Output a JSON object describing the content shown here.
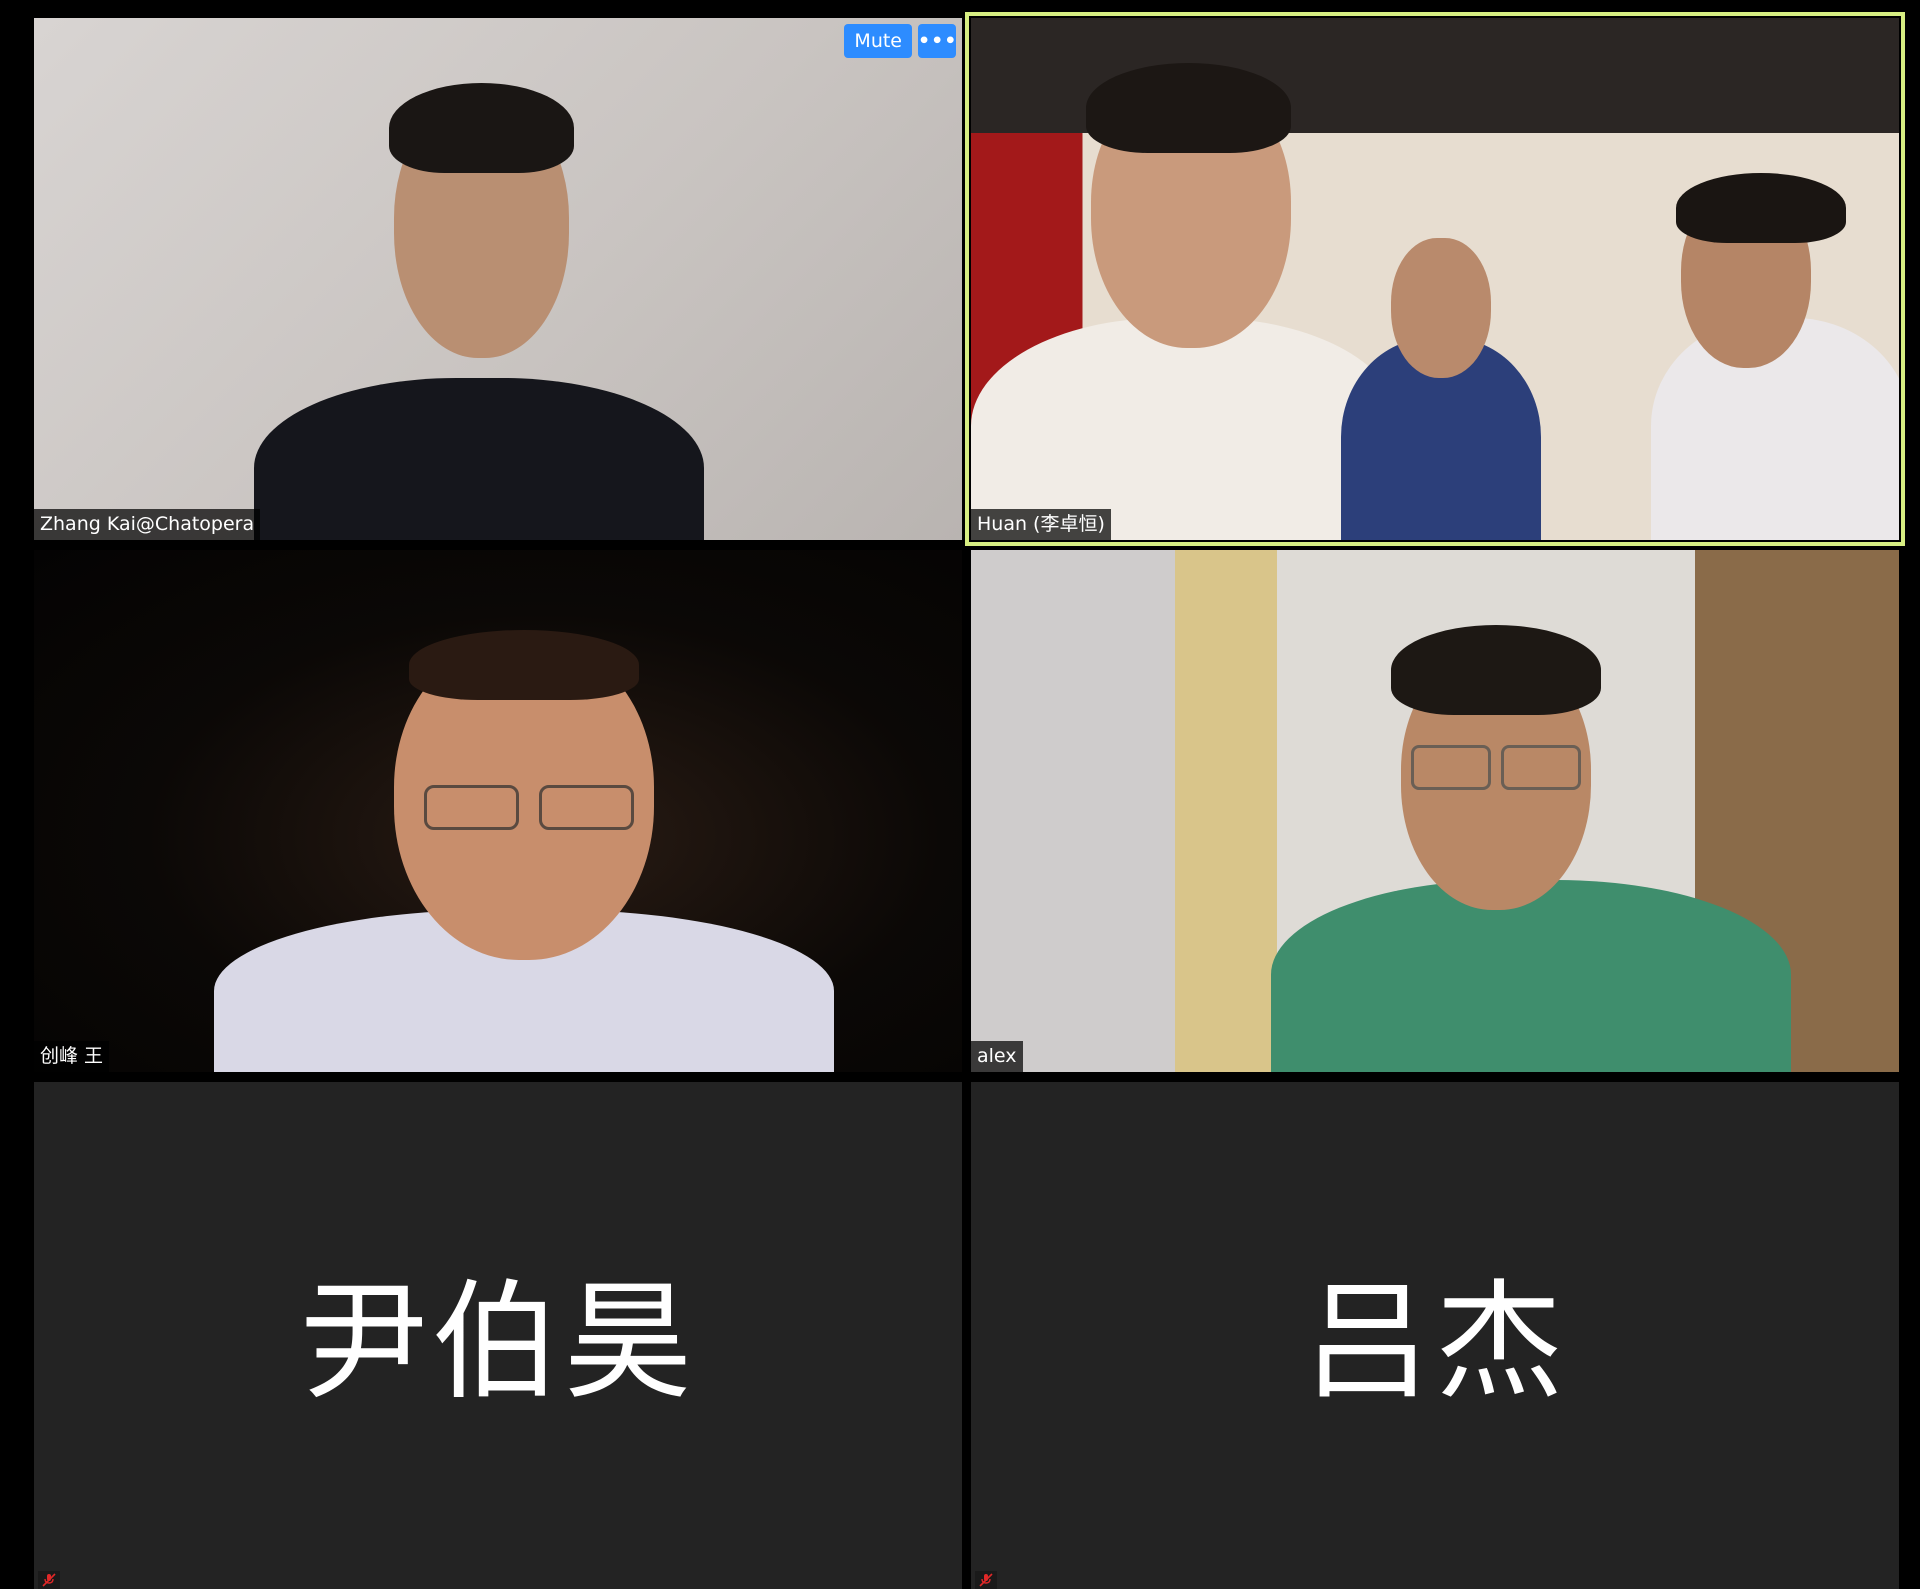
{
  "toolbar": {
    "mute_label": "Mute",
    "more_label": "•••"
  },
  "participants": [
    {
      "name": "Zhang Kai@Chatopera",
      "video": "on",
      "active_speaker": false
    },
    {
      "name": "Huan (李卓恒)",
      "video": "on",
      "active_speaker": true
    },
    {
      "name": "创峰 王",
      "video": "on",
      "active_speaker": false
    },
    {
      "name": "alex",
      "video": "on",
      "active_speaker": false
    },
    {
      "name": "尹伯昊",
      "video": "off",
      "muted": true
    },
    {
      "name": "吕杰",
      "video": "off",
      "muted": true
    }
  ],
  "colors": {
    "active_speaker_border": "#d7ee82",
    "button_blue": "#2d8cff",
    "video_off_bg": "#232323",
    "mute_icon": "#e02828"
  },
  "icons": {
    "muted": "microphone-muted-icon",
    "more": "ellipsis-icon"
  }
}
